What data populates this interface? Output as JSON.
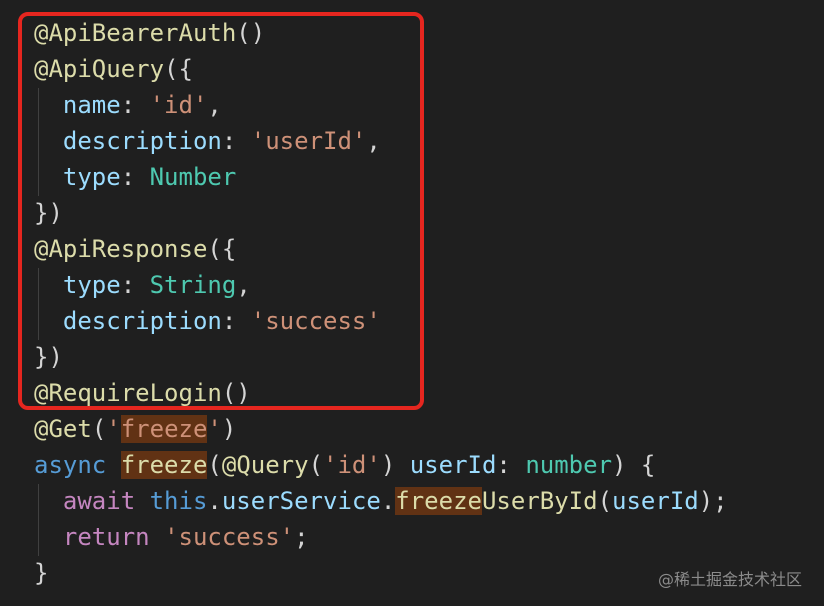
{
  "editor": {
    "lines": [
      {
        "tokens": [
          [
            "@",
            "dec"
          ],
          [
            "ApiBearerAuth",
            "dec"
          ],
          [
            "()",
            "punc"
          ]
        ]
      },
      {
        "tokens": [
          [
            "@",
            "dec"
          ],
          [
            "ApiQuery",
            "dec"
          ],
          [
            "({",
            "punc"
          ]
        ]
      },
      {
        "tokens": [
          [
            "  ",
            "punc"
          ],
          [
            "name",
            "prop"
          ],
          [
            ": ",
            "punc"
          ],
          [
            "'id'",
            "str"
          ],
          [
            ",",
            "punc"
          ]
        ]
      },
      {
        "tokens": [
          [
            "  ",
            "punc"
          ],
          [
            "description",
            "prop"
          ],
          [
            ": ",
            "punc"
          ],
          [
            "'userId'",
            "str"
          ],
          [
            ",",
            "punc"
          ]
        ]
      },
      {
        "tokens": [
          [
            "  ",
            "punc"
          ],
          [
            "type",
            "prop"
          ],
          [
            ": ",
            "punc"
          ],
          [
            "Number",
            "type"
          ]
        ]
      },
      {
        "tokens": [
          [
            "})",
            "punc"
          ]
        ]
      },
      {
        "tokens": [
          [
            "@",
            "dec"
          ],
          [
            "ApiResponse",
            "dec"
          ],
          [
            "({",
            "punc"
          ]
        ]
      },
      {
        "tokens": [
          [
            "  ",
            "punc"
          ],
          [
            "type",
            "prop"
          ],
          [
            ": ",
            "punc"
          ],
          [
            "String",
            "type"
          ],
          [
            ",",
            "punc"
          ]
        ]
      },
      {
        "tokens": [
          [
            "  ",
            "punc"
          ],
          [
            "description",
            "prop"
          ],
          [
            ": ",
            "punc"
          ],
          [
            "'success'",
            "str"
          ]
        ]
      },
      {
        "tokens": [
          [
            "})",
            "punc"
          ]
        ]
      },
      {
        "tokens": [
          [
            "@",
            "dec"
          ],
          [
            "RequireLogin",
            "dec"
          ],
          [
            "()",
            "punc"
          ]
        ]
      },
      {
        "tokens": [
          [
            "@",
            "dec"
          ],
          [
            "Get",
            "dec"
          ],
          [
            "(",
            "punc"
          ],
          [
            "'",
            "str"
          ],
          [
            "freeze",
            "str",
            true
          ],
          [
            "'",
            "str"
          ],
          [
            ")",
            "punc"
          ]
        ]
      },
      {
        "tokens": [
          [
            "async",
            "kw"
          ],
          [
            " ",
            "punc"
          ],
          [
            "freeze",
            "fn",
            true
          ],
          [
            "(",
            "punc"
          ],
          [
            "@",
            "dec"
          ],
          [
            "Query",
            "dec"
          ],
          [
            "(",
            "punc"
          ],
          [
            "'id'",
            "str"
          ],
          [
            ") ",
            "punc"
          ],
          [
            "userId",
            "var"
          ],
          [
            ": ",
            "punc"
          ],
          [
            "number",
            "type"
          ],
          [
            ") {",
            "punc"
          ]
        ]
      },
      {
        "tokens": [
          [
            "  ",
            "punc"
          ],
          [
            "await",
            "ctrl"
          ],
          [
            " ",
            "punc"
          ],
          [
            "this",
            "kw"
          ],
          [
            ".",
            "punc"
          ],
          [
            "userService",
            "var"
          ],
          [
            ".",
            "punc"
          ],
          [
            "freeze",
            "fn",
            true
          ],
          [
            "UserById",
            "fn"
          ],
          [
            "(",
            "punc"
          ],
          [
            "userId",
            "var"
          ],
          [
            ");",
            "punc"
          ]
        ]
      },
      {
        "tokens": [
          [
            "  ",
            "punc"
          ],
          [
            "return",
            "ctrl"
          ],
          [
            " ",
            "punc"
          ],
          [
            "'success'",
            "str"
          ],
          [
            ";",
            "punc"
          ]
        ]
      },
      {
        "tokens": [
          [
            "}",
            "punc"
          ]
        ]
      }
    ]
  },
  "colors": {
    "background": "#1f1f1f",
    "decorator": "#dcdcaa",
    "property": "#9cdcfe",
    "string": "#ce9178",
    "type": "#4ec9b0",
    "keyword": "#569cd6",
    "control": "#c586c0",
    "highlight": "#613214",
    "annotation_box": "#e5261f"
  },
  "watermark": "@稀土掘金技术社区"
}
